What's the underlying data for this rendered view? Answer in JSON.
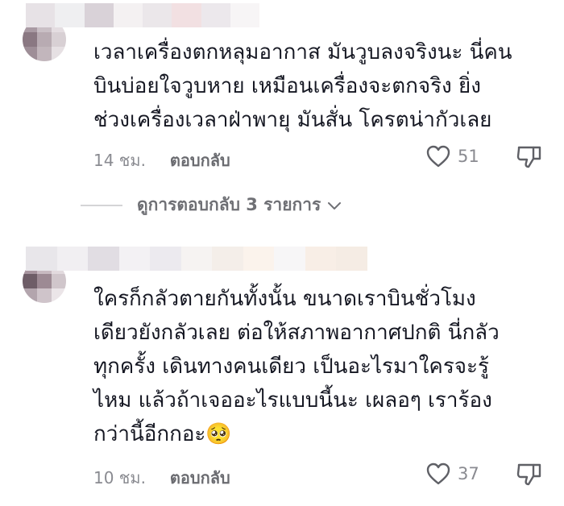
{
  "comments": [
    {
      "lines": [
        "เวลาเครื่องตกหลุมอากาส มันวูบลงจริงนะ นี่คน",
        "บินบ่อยใจวูบหาย เหมือนเครื่องจะตกจริง ยิ่ง",
        "ช่วงเครื่องเวลาฝ่าพายุ มันสั่น โครตน่ากัวเลย"
      ],
      "time": "14 ชม.",
      "reply_label": "ตอบกลับ",
      "likes": "51"
    },
    {
      "lines": [
        "ใครก็กลัวตายกันทั้งนั้น ขนาดเราบินชั่วโมง",
        "เดียวยังกลัวเลย ต่อให้สภาพอากาศปกติ นี่กลัว",
        "ทุกครั้ง เดินทางคนเดียว เป็นอะไรมาใครจะรู้",
        "ไหม แล้วถ้าเจออะไรแบบนี้นะ เผลอๆ เราร้อง",
        "กว่านี้อีกกอะ🥺"
      ],
      "time": "10 ชม.",
      "reply_label": "ตอบกลับ",
      "likes": "37"
    }
  ],
  "view_replies_label": "ดูการตอบกลับ 3 รายการ",
  "icons": {
    "like": "heart-outline-icon",
    "dislike": "thumbs-down-outline-icon",
    "expand": "chevron-down-icon"
  },
  "colors": {
    "text": "#161823",
    "meta": "#8a8b91",
    "divider": "#d4d4d6"
  }
}
